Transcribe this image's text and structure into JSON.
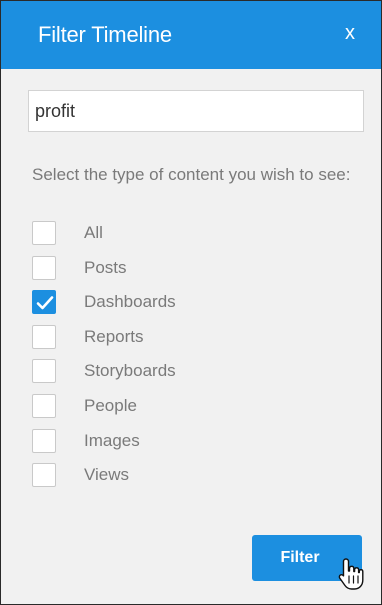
{
  "dialog": {
    "title": "Filter Timeline",
    "close_label": "x"
  },
  "search": {
    "value": "profit",
    "placeholder": ""
  },
  "prompt": "Select the type of content you wish to see:",
  "options": [
    {
      "label": "All",
      "checked": false
    },
    {
      "label": "Posts",
      "checked": false
    },
    {
      "label": "Dashboards",
      "checked": true
    },
    {
      "label": "Reports",
      "checked": false
    },
    {
      "label": "Storyboards",
      "checked": false
    },
    {
      "label": "People",
      "checked": false
    },
    {
      "label": "Images",
      "checked": false
    },
    {
      "label": "Views",
      "checked": false
    }
  ],
  "filter_button": {
    "label": "Filter"
  },
  "colors": {
    "accent": "#1c8fe0",
    "panel_bg": "#f1f1f1",
    "text_muted": "#7a7a7a"
  },
  "icons": {
    "close": "close-icon",
    "check": "checkmark-icon",
    "cursor": "hand-pointer-icon"
  }
}
